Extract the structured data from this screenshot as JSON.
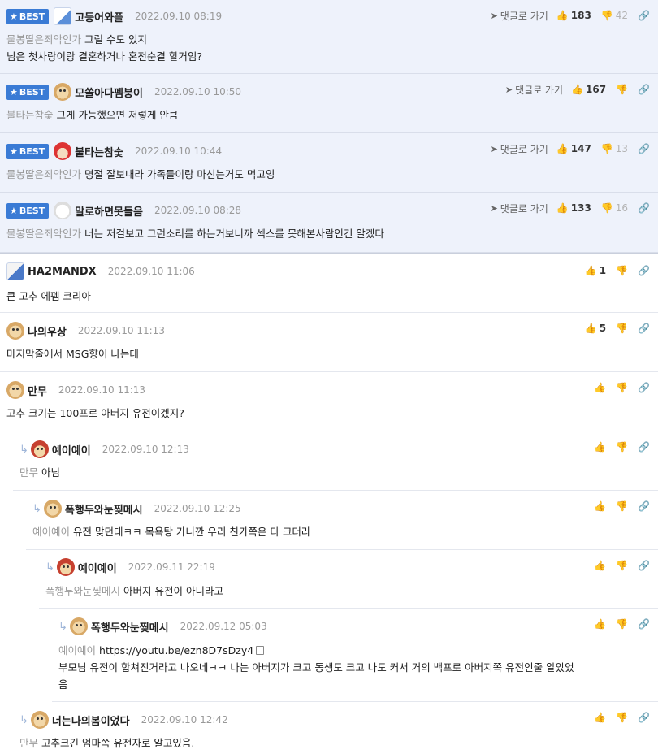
{
  "labels": {
    "best": "BEST",
    "reply_link": "댓글로 가기"
  },
  "icons": {
    "star": "★",
    "plane": "➤",
    "thumbs_up": "👍",
    "thumbs_down": "👎",
    "link": "🔗",
    "reply_arrow": "↳"
  },
  "colors": {
    "best_badge": "#3a7bd5",
    "best_bg": "#eef2fb",
    "muted": "#999999"
  },
  "comments": [
    {
      "best": true,
      "nick": "고등어와플",
      "date": "2022.09.10 08:19",
      "reply_to": "물봉딸은죄악인가",
      "lines": [
        "그럴 수도 있지",
        "님은 첫사랑이랑 결혼하거나 혼전순결 할거임?"
      ],
      "likes": "183",
      "dislikes": "42"
    },
    {
      "best": true,
      "nick": "모쏠아다펨붕이",
      "date": "2022.09.10 10:50",
      "reply_to": "불타는참숯",
      "lines": [
        "그게 가능했으면 저렇게 안큼"
      ],
      "likes": "167",
      "dislikes": ""
    },
    {
      "best": true,
      "nick": "불타는참숯",
      "date": "2022.09.10 10:44",
      "reply_to": "물봉딸은죄악인가",
      "lines": [
        "명절 잘보내라 가족들이랑 마신는거도 먹고잉"
      ],
      "likes": "147",
      "dislikes": "13"
    },
    {
      "best": true,
      "nick": "말로하면못들음",
      "date": "2022.09.10 08:28",
      "reply_to": "물봉딸은죄악인가",
      "lines": [
        "너는 저걸보고 그런소리를 하는거보니까 섹스를 못해본사람인건 알겠다"
      ],
      "likes": "133",
      "dislikes": "16"
    },
    {
      "best": false,
      "nick": "HA2MANDX",
      "date": "2022.09.10 11:06",
      "reply_to": "",
      "lines": [
        "큰 고추 에펨 코리아"
      ],
      "likes": "1",
      "dislikes": ""
    },
    {
      "best": false,
      "nick": "나의우상",
      "date": "2022.09.10 11:13",
      "reply_to": "",
      "lines": [
        "마지막줄에서 MSG향이 나는데"
      ],
      "likes": "5",
      "dislikes": ""
    },
    {
      "best": false,
      "nick": "만무",
      "date": "2022.09.10 11:13",
      "reply_to": "",
      "lines": [
        "고추 크기는 100프로 아버지 유전이겠지?"
      ],
      "likes": "",
      "dislikes": ""
    },
    {
      "best": false,
      "nick": "예이예이",
      "date": "2022.09.10 12:13",
      "reply_to": "만무",
      "lines": [
        "아님"
      ],
      "likes": "",
      "dislikes": ""
    },
    {
      "best": false,
      "nick": "폭행두와눈찢메시",
      "date": "2022.09.10 12:25",
      "reply_to": "예이예이",
      "lines": [
        "유전 맞던데ㅋㅋ 목욕탕 가니깐 우리 친가쪽은 다 크더라"
      ],
      "likes": "",
      "dislikes": ""
    },
    {
      "best": false,
      "nick": "예이예이",
      "date": "2022.09.11 22:19",
      "reply_to": "폭행두와눈찢메시",
      "lines": [
        "아버지 유전이 아니라고"
      ],
      "likes": "",
      "dislikes": ""
    },
    {
      "best": false,
      "nick": "폭행두와눈찢메시",
      "date": "2022.09.12 05:03",
      "reply_to": "예이예이",
      "url": "https://youtu.be/ezn8D7sDzy4",
      "lines": [
        "부모님 유전이 합쳐진거라고 나오네ㅋㅋ 나는 아버지가 크고 동생도 크고 나도 커서 거의 백프로 아버지쪽 유전인줄 알았었",
        "음"
      ],
      "likes": "",
      "dislikes": ""
    },
    {
      "best": false,
      "nick": "너는나의봄이었다",
      "date": "2022.09.10 12:42",
      "reply_to": "만무",
      "lines": [
        "고추크긴 엄마쪽 유전자로 알고있음."
      ],
      "likes": "",
      "dislikes": ""
    }
  ]
}
